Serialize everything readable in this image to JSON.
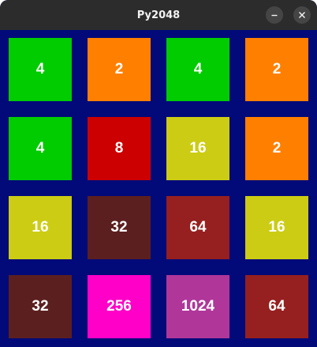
{
  "window": {
    "title": "Py2048",
    "background_color": "#010a78"
  },
  "board": {
    "rows": [
      [
        {
          "value": "4",
          "color": "#00cc00"
        },
        {
          "value": "2",
          "color": "#ff7f00"
        },
        {
          "value": "4",
          "color": "#00cc00"
        },
        {
          "value": "2",
          "color": "#ff7f00"
        }
      ],
      [
        {
          "value": "4",
          "color": "#00cc00"
        },
        {
          "value": "8",
          "color": "#cc0000"
        },
        {
          "value": "16",
          "color": "#cccc14"
        },
        {
          "value": "2",
          "color": "#ff7f00"
        }
      ],
      [
        {
          "value": "16",
          "color": "#cccc14"
        },
        {
          "value": "32",
          "color": "#5c1f1f"
        },
        {
          "value": "64",
          "color": "#961f1f"
        },
        {
          "value": "16",
          "color": "#cccc14"
        }
      ],
      [
        {
          "value": "32",
          "color": "#5c1f1f"
        },
        {
          "value": "256",
          "color": "#ff00c8"
        },
        {
          "value": "1024",
          "color": "#b0369a"
        },
        {
          "value": "64",
          "color": "#961f1f"
        }
      ]
    ]
  },
  "icons": {
    "minimize": "minimize-icon",
    "close": "close-icon"
  }
}
